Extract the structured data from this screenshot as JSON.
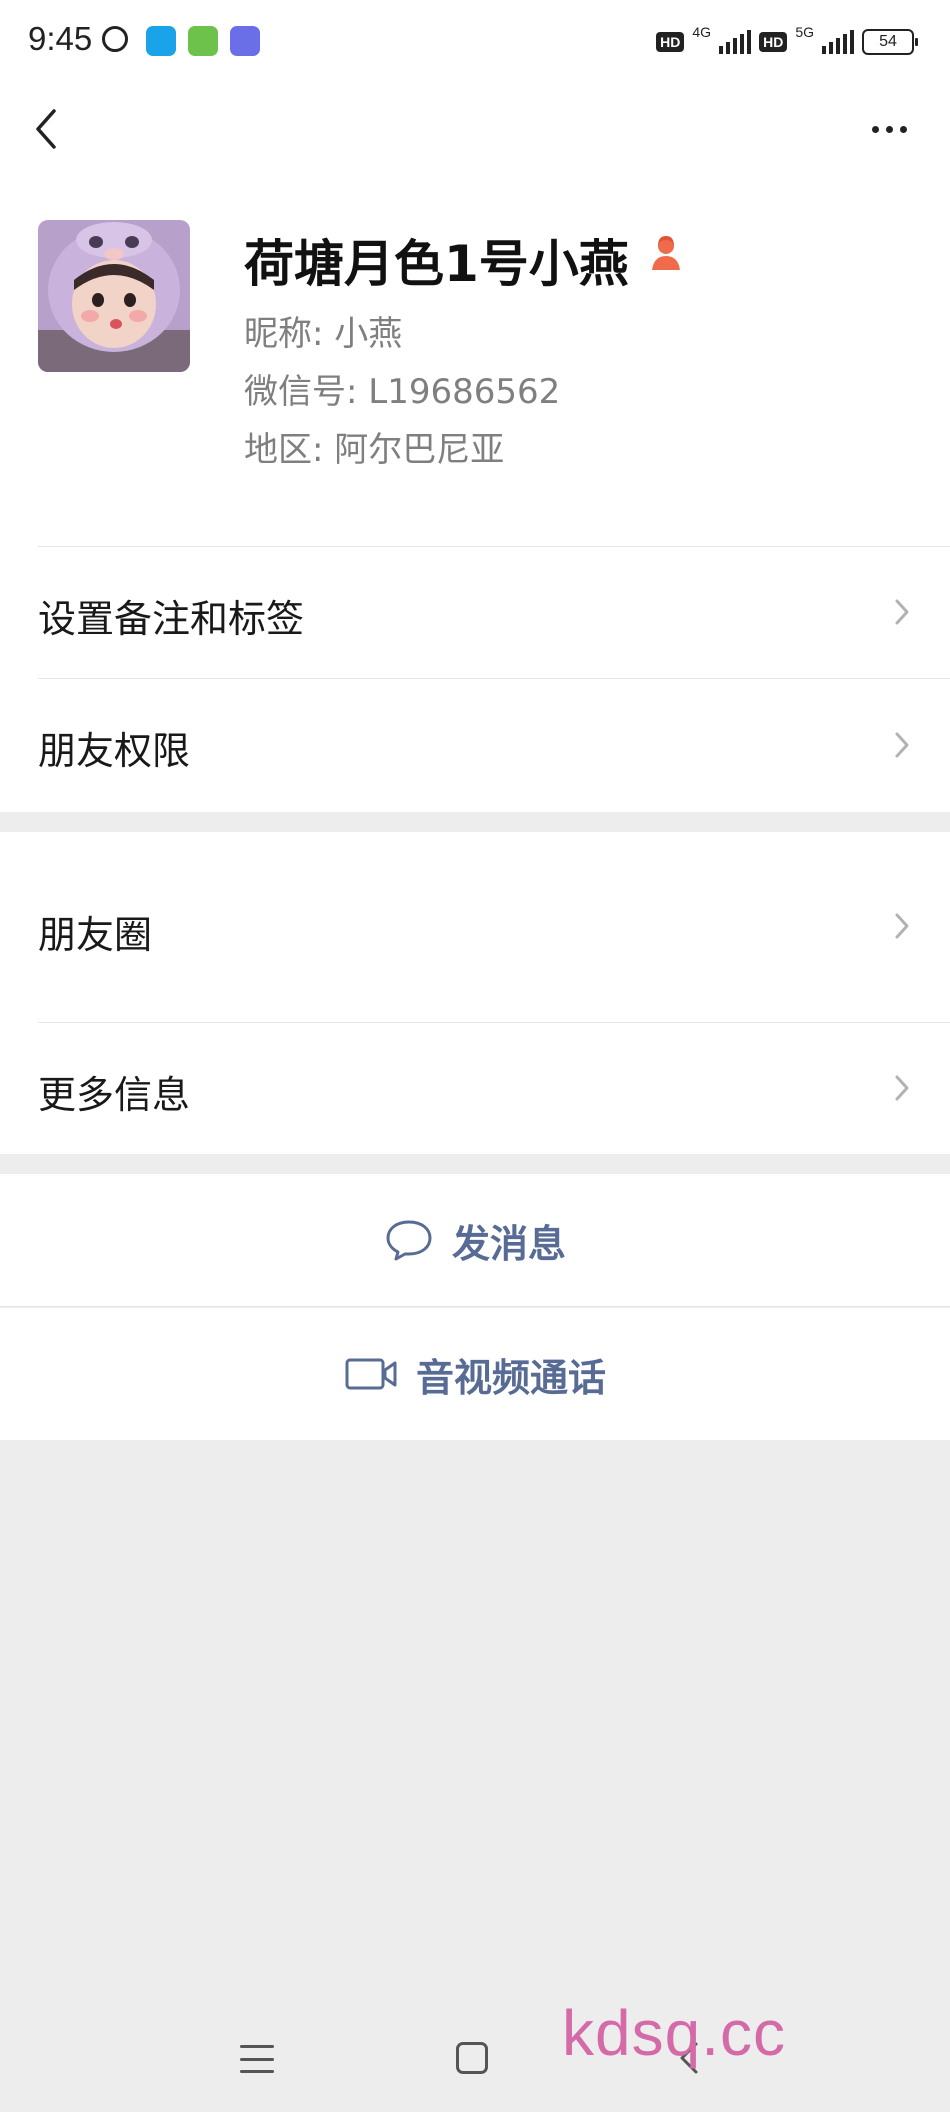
{
  "status_bar": {
    "time": "9:45",
    "hd_1": "HD",
    "network_1": "4G",
    "hd_2": "HD",
    "network_2": "5G",
    "battery": "54"
  },
  "profile": {
    "remark_name": "荷塘月色1号小燕",
    "nickname_label": "昵称:",
    "nickname": "小燕",
    "wechat_id_label": "微信号:",
    "wechat_id": "L19686562",
    "region_label": "地区:",
    "region": "阿尔巴尼亚"
  },
  "menu": {
    "remark_tags": "设置备注和标签",
    "friend_permissions": "朋友权限",
    "moments": "朋友圈",
    "more_info": "更多信息"
  },
  "actions": {
    "send_message": "发消息",
    "video_call": "音视频通话"
  },
  "watermark": "kdsq.cc",
  "colors": {
    "link_blue": "#576b95",
    "background_gray": "#ededed",
    "gender_icon": "#f06b4c",
    "watermark_pink": "#d46aa8"
  },
  "icons": [
    "back-arrow-icon",
    "more-dots-icon",
    "chevron-right-icon",
    "chat-bubble-icon",
    "video-camera-icon",
    "female-person-icon"
  ]
}
